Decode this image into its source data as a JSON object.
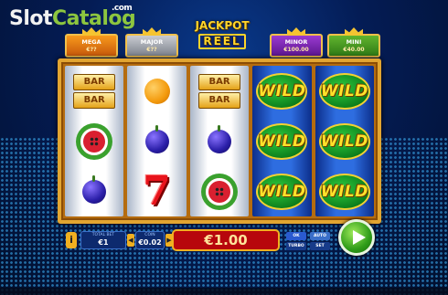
{
  "logo": {
    "part1": "Slot",
    "part2": "Catalog",
    "domain": ".com"
  },
  "jackpots": [
    {
      "name": "MEGA",
      "value": "€??"
    },
    {
      "name": "MAJOR",
      "value": "€??"
    },
    {
      "name": "MINOR",
      "value": "€100.00"
    },
    {
      "name": "MINI",
      "value": "€40.00"
    }
  ],
  "jackpot_reel": {
    "line1": "JACKPOT",
    "line2": "REEL"
  },
  "reels": [
    [
      "bar-bar",
      "watermelon",
      "plum"
    ],
    [
      "orange",
      "plum",
      "seven"
    ],
    [
      "bar-bar",
      "plum",
      "watermelon"
    ],
    [
      "wild",
      "wild",
      "wild"
    ],
    [
      "wild",
      "wild",
      "wild"
    ]
  ],
  "symbols": {
    "bar": "BAR",
    "wild": "WILD",
    "seven": "7"
  },
  "panel": {
    "info": "i",
    "total_bet_label": "TOTAL BET",
    "total_bet": "€1",
    "coin_label": "COIN",
    "coin": "€0.02",
    "win": "€1.00",
    "ok": "OK",
    "auto": "AUTO",
    "turbo": "TURBO",
    "set": "SET"
  },
  "colors": {
    "frame": "#e2a531",
    "win_box": "#b7060c",
    "spin": "#2f9c19"
  }
}
